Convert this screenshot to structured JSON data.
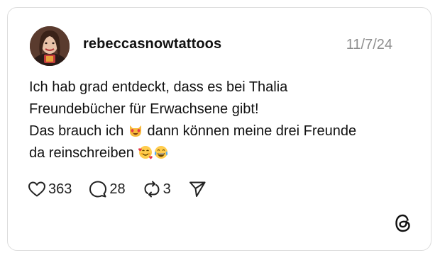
{
  "post": {
    "username": "rebeccasnowtattoos",
    "date": "11/7/24",
    "text": {
      "line1": "Ich hab grad entdeckt, dass es bei Thalia",
      "line2": "Freundebücher für Erwachsene gibt!",
      "line3_before_emoji": "Das brauch ich ",
      "line3_after_emoji": " dann können meine drei Freunde",
      "line4": "da reinschreiben "
    },
    "emojis": [
      "smiling-cat-heart-eyes-emoji",
      "smiling-face-with-hearts-emoji",
      "face-with-tears-of-joy-emoji"
    ]
  },
  "actions": {
    "likes": "363",
    "comments": "28",
    "reposts": "3"
  },
  "icons": [
    "heart-icon",
    "comment-icon",
    "repost-icon",
    "share-icon",
    "threads-logo-icon"
  ],
  "colors": {
    "text": "#111111",
    "muted": "#8e8e8e",
    "border": "#dcdcdc"
  }
}
